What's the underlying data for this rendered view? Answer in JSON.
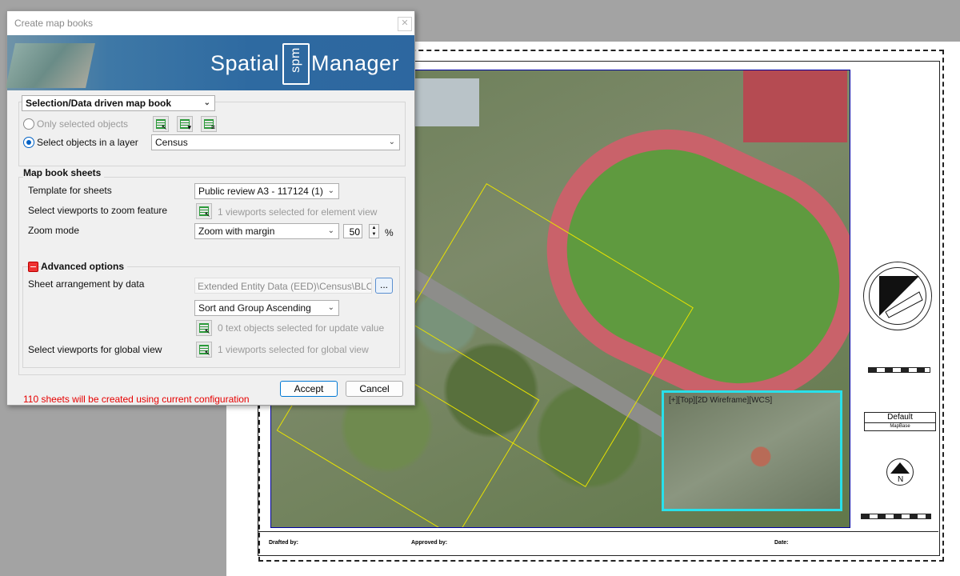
{
  "dialog": {
    "title": "Create map books",
    "close_glyph": "✕",
    "brand": {
      "left": "Spatial",
      "mid": "spm",
      "right": "Manager"
    },
    "mode_select": "Selection/Data driven map book",
    "radio_only_selected": "Only selected objects",
    "radio_layer": "Select objects in a layer",
    "layer_select": "Census",
    "sheets_section": "Map book sheets",
    "template_label": "Template for sheets",
    "template_value": "Public review A3 - 117124 (1)",
    "viewports_zoom_label": "Select viewports to zoom feature",
    "viewports_zoom_status": "1 viewports selected for element view",
    "zoom_mode_label": "Zoom mode",
    "zoom_mode_value": "Zoom with margin",
    "zoom_margin": "50",
    "zoom_unit": "%",
    "advanced_section": "Advanced options",
    "arrangement_label": "Sheet arrangement by data",
    "arrangement_value": "Extended Entity Data (EED)\\Census\\BLOCK",
    "arrangement_browse": "...",
    "sort_value": "Sort and Group Ascending",
    "text_objects_status": "0 text objects selected for update value",
    "global_view_label": "Select viewports for global view",
    "global_view_status": "1 viewports selected for global view",
    "status_message": "110 sheets will be created using current configuration",
    "accept_label": "Accept",
    "cancel_label": "Cancel",
    "checked_radio": "layer",
    "colors": {
      "status": "#e60000",
      "accent": "#0061c5",
      "banner": "#2e6aa1"
    }
  },
  "drawing": {
    "inset_label": "[+][Top][2D Wireframe][WCS]",
    "legend_title": "Default",
    "legend_subtitle": "MapBase",
    "drafted_by": "Drafted by:",
    "approved_by": "Approved by:",
    "date": "Date:",
    "north_glyph": "N",
    "colors": {
      "inset_border": "#29e0ea",
      "viewport_border": "#0000a0",
      "poly": "#e8e200"
    }
  }
}
